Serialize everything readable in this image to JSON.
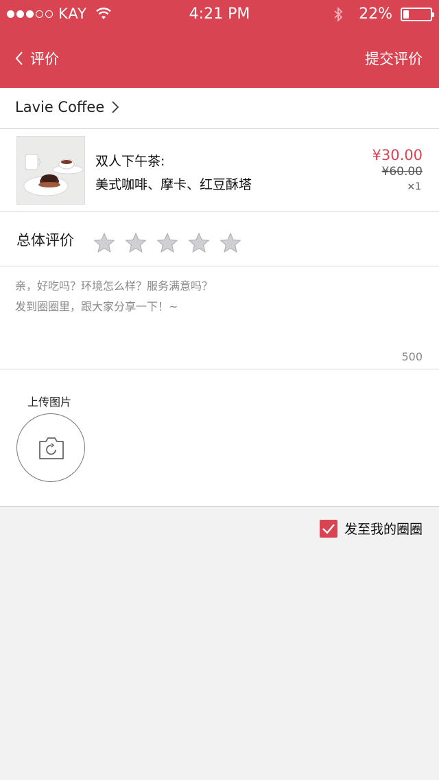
{
  "status_bar": {
    "carrier": "KAY",
    "time": "4:21 PM",
    "battery": "22%",
    "battery_level": 0.22,
    "signal_dots": [
      true,
      true,
      true,
      false,
      false
    ]
  },
  "nav": {
    "back_label": "评价",
    "submit_label": "提交评价"
  },
  "shop": {
    "name": "Lavie Coffee"
  },
  "order": {
    "title_line1": "双人下午茶:",
    "title_line2": "美式咖啡、摩卡、红豆酥塔",
    "price_now": "¥30.00",
    "price_old": "¥60.00",
    "quantity": "×1"
  },
  "rating": {
    "label": "总体评价",
    "max_stars": 5,
    "selected": 0
  },
  "comment": {
    "placeholder": "亲，好吃吗？环境怎么样？服务满意吗？\n发到圈圈里，跟大家分享一下！~",
    "value": "",
    "remaining": "500"
  },
  "upload": {
    "label": "上传图片"
  },
  "share": {
    "label": "发至我的圈圈",
    "checked": true
  },
  "colors": {
    "brand": "#d94452",
    "background": "#f2f2f2"
  }
}
